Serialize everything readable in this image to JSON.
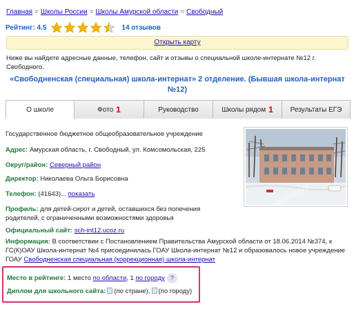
{
  "breadcrumb": {
    "items": [
      "Главная",
      "Школы России",
      "Школы Амурской области",
      "Свободный"
    ],
    "separator": "="
  },
  "rating": {
    "label": "Рейтинг:",
    "value": "4.5",
    "stars": 4.5,
    "reviews": "14 отзывов"
  },
  "map": {
    "link": "Открыть карту"
  },
  "intro": "Ниже вы найдете адресные данные, телефон, сайт и отзывы о специальной школе-интернате №12 г. Свободного.",
  "school_title": "«Свободненская (специальная) школа-интернат» 2 отделение. (Бывшая школа-интернат №12)",
  "tabs": [
    {
      "label": "О школе",
      "count": ""
    },
    {
      "label": "Фото",
      "count": "1"
    },
    {
      "label": "Руководство",
      "count": ""
    },
    {
      "label": "Школы рядом",
      "count": "1"
    },
    {
      "label": "Результаты ЕГЭ",
      "count": ""
    }
  ],
  "details": {
    "org_type": "Государственное бюджетное общеобразовательное учреждение",
    "address_label": "Адрес:",
    "address": "Амурская область, г. Свободный, ул. Комсомольская, 225",
    "district_label": "Округ/район:",
    "district": "Северный район",
    "director_label": "Директор:",
    "director": "Николаева Ольга Борисовна",
    "phone_label": "Телефон:",
    "phone": "(41643)...",
    "phone_show": "показать",
    "profile_label": "Профиль:",
    "profile_line1": "для детей-сирот и детей, оставшихся без попечения",
    "profile_line2": "родителей, с ограниченными возможностями здоровья",
    "site_label": "Официальный сайт:",
    "site": "sch-int12.ucoz.ru",
    "info_label": "Информация:",
    "info_line1": "В соответствии с Постановлением Правительства Амурской области от 18.06.2014 №374, к",
    "info_line2": "ГС(К)ОАУ Школа-интернат №4 присоединилась ГОАУ Школа-интернат №12 и образовалось новое учреждение",
    "info_line3_prefix": "ГОАУ",
    "info_link": "Свободненская специальная (коррекционная) школа-интернат"
  },
  "photo": {
    "watermark": "schoolotzyv"
  },
  "rating_box": {
    "place_label": "Место в рейтинге:",
    "place_text_1": "1 место",
    "place_link_region": "по области",
    "place_text_2": ", 1",
    "place_link_city": "по городу",
    "qmark": "?",
    "diploma_label": "Диплом для школьного сайта:",
    "diploma_country": "(по стране),",
    "diploma_city": "(по городу)"
  },
  "colors": {
    "accent_blue": "#1f5fbf",
    "label_green": "#1f7a3a",
    "star": "#f4b400",
    "tab_count_red": "#d60000",
    "highlight_border": "#d2346b",
    "map_bar_bg": "#fdf6cf"
  }
}
